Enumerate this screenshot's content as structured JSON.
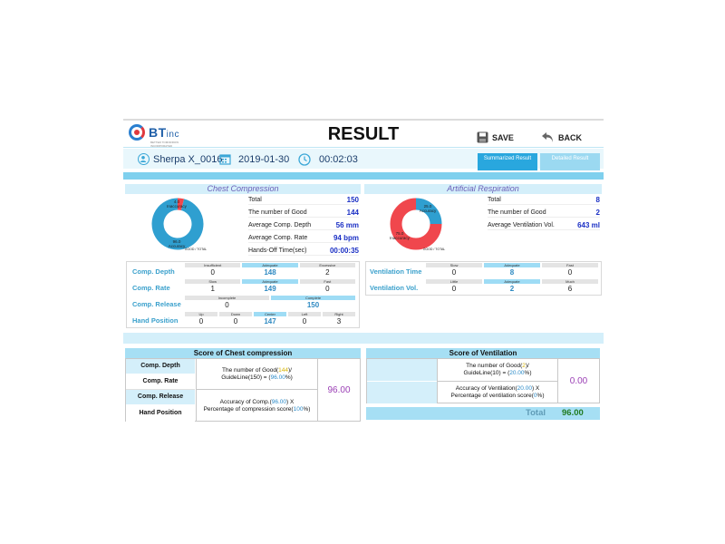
{
  "header": {
    "logo_text": "BT",
    "logo_suffix": "inc",
    "logo_tagline": "BETTER TOMORROW INCORPORATED",
    "title": "RESULT",
    "save_label": "SAVE",
    "back_label": "BACK"
  },
  "info": {
    "user": "Sherpa X_0016",
    "date": "2019-01-30",
    "time": "00:02:03",
    "tabs": [
      "Summarized Result",
      "Detailed Result"
    ]
  },
  "chest": {
    "title": "Chest Compression",
    "donut": {
      "good": 96.0,
      "bad": 4.0,
      "good_label": "96.0",
      "good_name": "Accuracy",
      "bad_label": "4.0",
      "bad_name": "Inaccuracy",
      "legend": "GOOD / TOTAL"
    },
    "stats": [
      {
        "label": "Total",
        "value": "150"
      },
      {
        "label": "The number of Good",
        "value": "144"
      },
      {
        "label": "Average Comp. Depth",
        "value": "56 mm"
      },
      {
        "label": "Average Comp. Rate",
        "value": "94 bpm"
      },
      {
        "label": "Hands-Off Time(sec)",
        "value": "00:00:35"
      }
    ],
    "metrics": [
      {
        "label": "Comp. Depth",
        "cells": [
          {
            "h": "Insufficient",
            "n": "0"
          },
          {
            "h": "Adequate",
            "n": "148",
            "on": true
          },
          {
            "h": "Excessive",
            "n": "2"
          }
        ]
      },
      {
        "label": "Comp. Rate",
        "cells": [
          {
            "h": "Slow",
            "n": "1"
          },
          {
            "h": "Adequate",
            "n": "149",
            "on": true
          },
          {
            "h": "Fast",
            "n": "0"
          }
        ]
      },
      {
        "label": "Comp. Release",
        "cells": [
          {
            "h": "Incomplete",
            "n": "0"
          },
          {
            "h": "Complete",
            "n": "150",
            "on": true
          }
        ]
      },
      {
        "label": "Hand Position",
        "cells": [
          {
            "h": "Up",
            "n": "0"
          },
          {
            "h": "Down",
            "n": "0"
          },
          {
            "h": "Center",
            "n": "147",
            "on": true
          },
          {
            "h": "Left",
            "n": "0"
          },
          {
            "h": "Right",
            "n": "3"
          }
        ]
      }
    ]
  },
  "resp": {
    "title": "Artificial Respiration",
    "donut": {
      "good": 25.0,
      "bad": 75.0,
      "good_label": "25.0",
      "good_name": "Accuracy",
      "bad_label": "75.0",
      "bad_name": "Inaccuracy",
      "legend": "GOOD / TOTAL"
    },
    "stats": [
      {
        "label": "Total",
        "value": "8"
      },
      {
        "label": "The number of Good",
        "value": "2"
      },
      {
        "label": "Average Ventilation Vol.",
        "value": "643 ml"
      }
    ],
    "metrics": [
      {
        "label": "Ventilation Time",
        "cells": [
          {
            "h": "Slow",
            "n": "0"
          },
          {
            "h": "Adequate",
            "n": "8",
            "on": true
          },
          {
            "h": "Fast",
            "n": "0"
          }
        ]
      },
      {
        "label": "Ventilation Vol.",
        "cells": [
          {
            "h": "Little",
            "n": "0"
          },
          {
            "h": "Adequate",
            "n": "2",
            "on": true
          },
          {
            "h": "Much",
            "n": "6"
          }
        ]
      }
    ]
  },
  "score_chest": {
    "title": "Score of Chest compression",
    "labels": [
      "Comp. Depth",
      "Comp. Rate",
      "Comp. Release",
      "Hand Position"
    ],
    "f1": {
      "a": "The number of Good(",
      "b": "144",
      "c": ")/",
      "d": "GuideLine(150) = (",
      "e": "96.00",
      "f": "%)"
    },
    "f2": {
      "a": "Accuracy of Comp.(",
      "b": "96.00",
      "c": ") X",
      "d": "Percentage of compression score(",
      "e": "100",
      "f": "%)"
    },
    "score": "96.00"
  },
  "score_vent": {
    "title": "Score of Ventilation",
    "f1": {
      "a": "The number of Good(",
      "b": "2",
      "c": ")/",
      "d": "GuideLine(10) = (",
      "e": "20.00",
      "f": "%)"
    },
    "f2": {
      "a": "Accuracy of Ventilation(",
      "b": "20.00",
      "c": ") X",
      "d": "Percentage of ventilation score(",
      "e": "0",
      "f": "%)"
    },
    "score": "0.00"
  },
  "total": {
    "label": "Total",
    "value": "96.00"
  },
  "colors": {
    "good": "#2f9fd0",
    "bad": "#f0474d",
    "accent": "#7fd0ee"
  }
}
